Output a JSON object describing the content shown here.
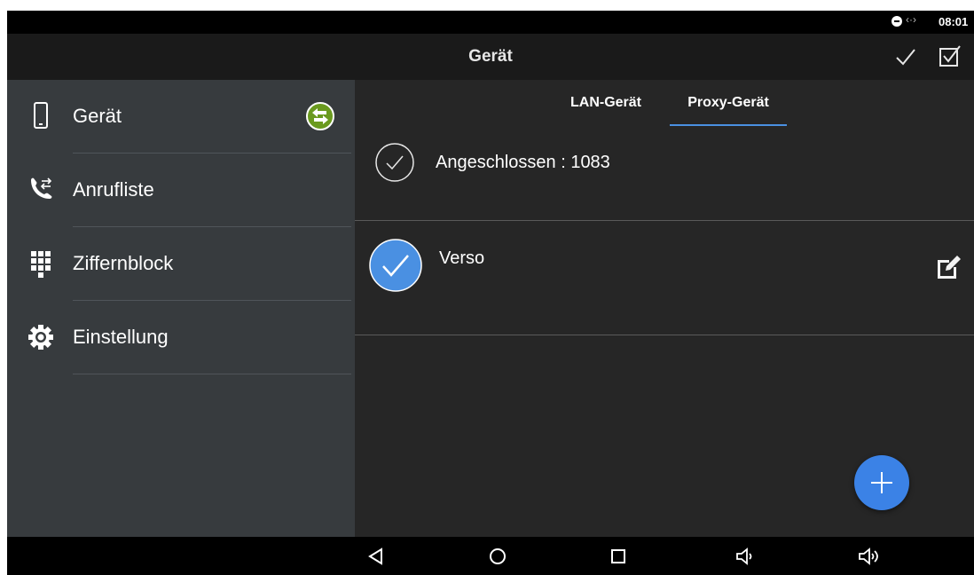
{
  "status_bar": {
    "data_indicator": "‹·›",
    "time": "08:01"
  },
  "app_bar": {
    "title": "Gerät"
  },
  "sidebar": {
    "items": [
      {
        "label": "Gerät",
        "icon": "phone-device-icon"
      },
      {
        "label": "Anrufliste",
        "icon": "call-log-icon"
      },
      {
        "label": "Ziffernblock",
        "icon": "dialpad-icon"
      },
      {
        "label": "Einstellung",
        "icon": "settings-gear-icon"
      }
    ]
  },
  "tabs": [
    {
      "label": "LAN-Gerät",
      "active": false
    },
    {
      "label": "Proxy-Gerät",
      "active": true
    }
  ],
  "connection": {
    "text": "Angeschlossen : 1083"
  },
  "devices": [
    {
      "name": "Verso",
      "selected": true
    }
  ],
  "colors": {
    "accent": "#4a90e2",
    "sidebar_bg": "#373b3e",
    "content_bg": "#262626",
    "sync_badge": "#6a9a1f"
  }
}
